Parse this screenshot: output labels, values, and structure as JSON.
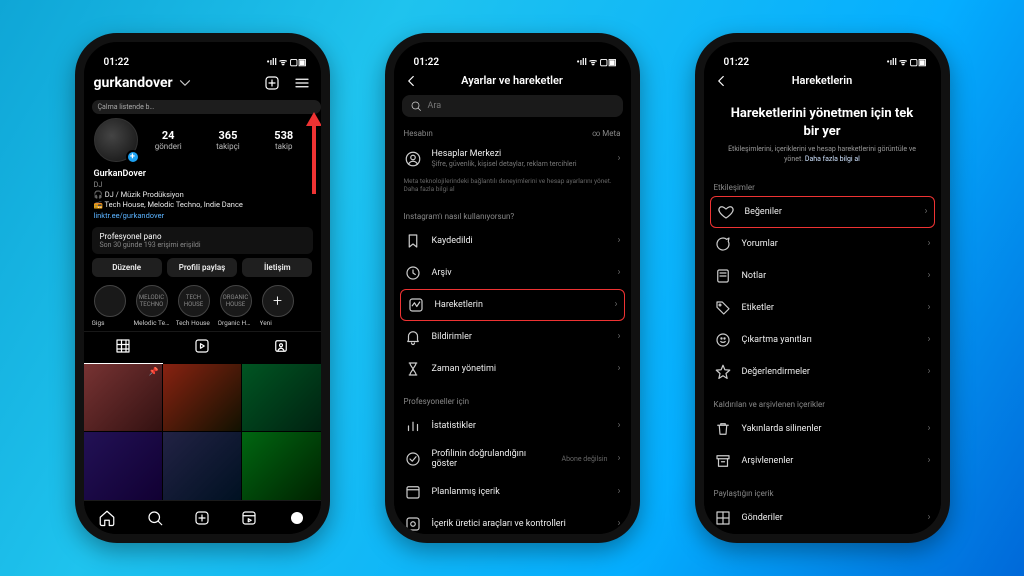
{
  "statusbar": {
    "time": "01:22",
    "right": "•ıll ᯤ ▢▣"
  },
  "phone1": {
    "username": "gurkandover",
    "story_badge": "Çalma listende b…",
    "stats": [
      {
        "n": "24",
        "l": "gönderi"
      },
      {
        "n": "365",
        "l": "takipçi"
      },
      {
        "n": "538",
        "l": "takip"
      }
    ],
    "bio": {
      "name": "GurkanDover",
      "category": "DJ",
      "line1": "🎧 DJ / Müzik Prodüksiyon",
      "line2": "📻 Tech House, Melodic Techno, Indie Dance",
      "link": "linktr.ee/gurkandover"
    },
    "panel": {
      "title": "Profesyonel pano",
      "sub": "Son 30 günde 193 erişimi erişildi"
    },
    "buttons": [
      "Düzenle",
      "Profili paylaş",
      "İletişim"
    ],
    "highlights": [
      {
        "circle": "",
        "label": "Gigs"
      },
      {
        "circle": "MELODIC TECHNO",
        "label": "Melodic Tec…"
      },
      {
        "circle": "TECH HOUSE",
        "label": "Tech House"
      },
      {
        "circle": "ORGANIC HOUSE",
        "label": "Organic Ho…"
      },
      {
        "circle": "+",
        "label": "Yeni"
      }
    ]
  },
  "phone2": {
    "title": "Ayarlar ve hareketler",
    "search_placeholder": "Ara",
    "section_account": "Hesabın",
    "meta_brand": "∞ Meta",
    "accounts_center": {
      "label": "Hesaplar Merkezi",
      "sub": "Şifre, güvenlik, kişisel detaylar, reklam tercihleri"
    },
    "accounts_note": "Meta teknolojilerindeki bağlantılı deneyimlerini ve hesap ayarlarını yönet. Daha fazla bilgi al",
    "section_usage": "Instagram'ı nasıl kullanıyorsun?",
    "items_usage": [
      {
        "icon": "bookmark",
        "label": "Kaydedildi"
      },
      {
        "icon": "clock",
        "label": "Arşiv"
      },
      {
        "icon": "activity",
        "label": "Hareketlerin",
        "highlight": true
      },
      {
        "icon": "bell",
        "label": "Bildirimler"
      },
      {
        "icon": "hourglass",
        "label": "Zaman yönetimi"
      }
    ],
    "section_pro": "Profesyoneller için",
    "items_pro": [
      {
        "icon": "stats",
        "label": "İstatistikler"
      },
      {
        "icon": "verify",
        "label": "Profilinin doğrulandığını göster",
        "status": "Abone değilsin"
      },
      {
        "icon": "calendar",
        "label": "Planlanmış içerik"
      },
      {
        "icon": "tools",
        "label": "İçerik üretici araçları ve kontrolleri"
      }
    ]
  },
  "phone3": {
    "title": "Hareketlerin",
    "hero": {
      "heading": "Hareketlerini yönetmen için tek bir yer",
      "body": "Etkileşimlerini, içeriklerini ve hesap hareketlerini görüntüle ve yönet.",
      "more": "Daha fazla bilgi al"
    },
    "section_etk": "Etkileşimler",
    "items_etk": [
      {
        "icon": "heart",
        "label": "Beğeniler",
        "highlight": true
      },
      {
        "icon": "comment",
        "label": "Yorumlar"
      },
      {
        "icon": "note",
        "label": "Notlar"
      },
      {
        "icon": "tag",
        "label": "Etiketler"
      },
      {
        "icon": "sticker",
        "label": "Çıkartma yanıtları"
      },
      {
        "icon": "star",
        "label": "Değerlendirmeler"
      }
    ],
    "section_removed": "Kaldırılan ve arşivlenen içerikler",
    "items_removed": [
      {
        "icon": "trash",
        "label": "Yakınlarda silinenler"
      },
      {
        "icon": "archive",
        "label": "Arşivlenenler"
      }
    ],
    "section_shared": "Paylaştığın içerik",
    "items_shared": [
      {
        "icon": "grid",
        "label": "Gönderiler"
      }
    ]
  }
}
